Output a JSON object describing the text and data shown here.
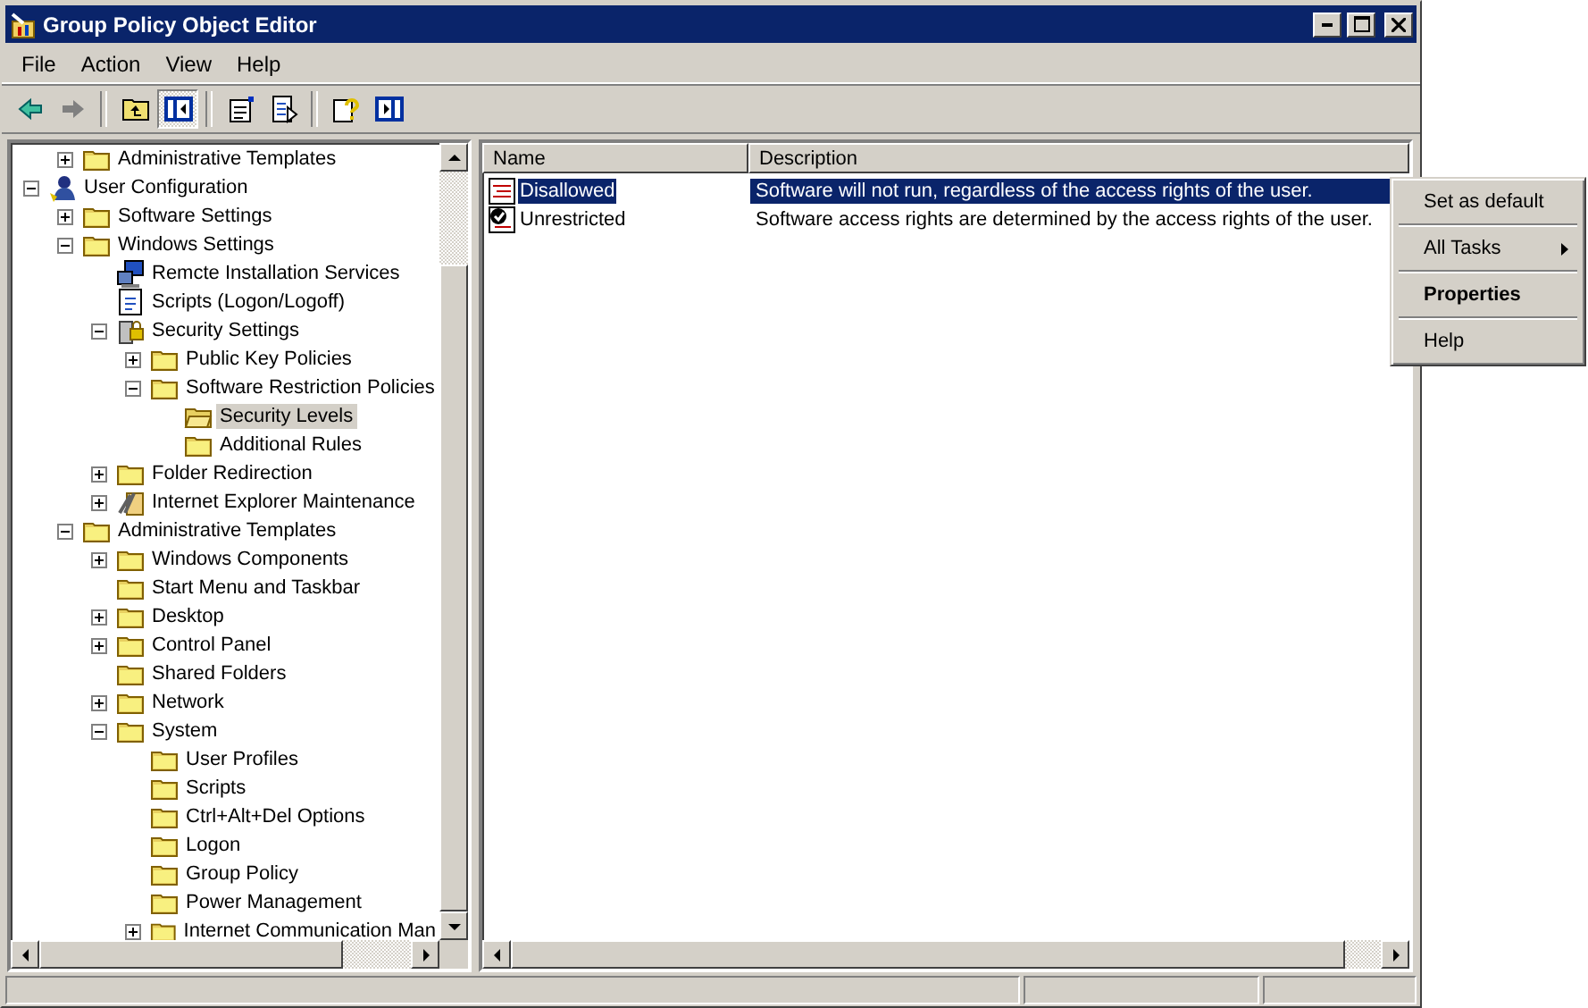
{
  "window": {
    "title": "Group Policy Object Editor"
  },
  "menu": [
    {
      "label": "File"
    },
    {
      "label": "Action"
    },
    {
      "label": "View"
    },
    {
      "label": "Help"
    }
  ],
  "toolbar": [
    {
      "kind": "back",
      "disabled": false
    },
    {
      "kind": "forward",
      "disabled": true
    },
    {
      "kind": "separator"
    },
    {
      "kind": "up",
      "pressed": false
    },
    {
      "kind": "tree",
      "pressed": true
    },
    {
      "kind": "separator"
    },
    {
      "kind": "properties",
      "pressed": false
    },
    {
      "kind": "export",
      "pressed": false
    },
    {
      "kind": "separator"
    },
    {
      "kind": "help",
      "pressed": false
    },
    {
      "kind": "pane",
      "pressed": false
    }
  ],
  "tree": [
    {
      "kind": "cut-off",
      "children": [
        {
          "label": "Administrative Templates",
          "kind": "folder",
          "expanded": false,
          "selected": false
        }
      ]
    },
    {
      "label": "User Configuration",
      "kind": "user",
      "expanded": true,
      "selected": false,
      "children": [
        {
          "label": "Software Settings",
          "kind": "folder",
          "expanded": false,
          "selected": false
        },
        {
          "label": "Windows Settings",
          "kind": "folder",
          "expanded": true,
          "selected": false,
          "children": [
            {
              "label": "Remcte Installation Services",
              "kind": "remote",
              "selected": false
            },
            {
              "label": "Scripts (Logon/Logoff)",
              "kind": "scripts",
              "selected": false
            },
            {
              "label": "Security Settings",
              "kind": "security",
              "expanded": true,
              "selected": false,
              "children": [
                {
                  "label": "Public Key Policies",
                  "kind": "folder",
                  "expanded": false,
                  "selected": false
                },
                {
                  "label": "Software Restriction Policies",
                  "kind": "folder",
                  "expanded": true,
                  "selected": false,
                  "children": [
                    {
                      "label": "Security Levels",
                      "kind": "open-folder",
                      "selected": true
                    },
                    {
                      "label": "Additional Rules",
                      "kind": "folder",
                      "selected": false
                    }
                  ]
                }
              ]
            },
            {
              "label": "Folder Redirection",
              "kind": "folder",
              "expanded": false,
              "selected": false
            },
            {
              "label": "Internet Explorer Maintenance",
              "kind": "ie",
              "expanded": false,
              "selected": false
            }
          ]
        },
        {
          "label": "Administrative Templates",
          "kind": "folder",
          "expanded": true,
          "selected": false,
          "children": [
            {
              "label": "Windows Components",
              "kind": "folder",
              "expanded": false,
              "selected": false
            },
            {
              "label": "Start Menu and Taskbar",
              "kind": "folder",
              "selected": false
            },
            {
              "label": "Desktop",
              "kind": "folder",
              "expanded": false,
              "selected": false
            },
            {
              "label": "Control Panel",
              "kind": "folder",
              "expanded": false,
              "selected": false
            },
            {
              "label": "Shared Folders",
              "kind": "folder",
              "selected": false
            },
            {
              "label": "Network",
              "kind": "folder",
              "expanded": false,
              "selected": false
            },
            {
              "label": "System",
              "kind": "folder",
              "expanded": true,
              "selected": false,
              "children": [
                {
                  "label": "User Profiles",
                  "kind": "folder",
                  "selected": false
                },
                {
                  "label": "Scripts",
                  "kind": "folder",
                  "selected": false
                },
                {
                  "label": "Ctrl+Alt+Del Options",
                  "kind": "folder",
                  "selected": false
                },
                {
                  "label": "Logon",
                  "kind": "folder",
                  "selected": false
                },
                {
                  "label": "Group Policy",
                  "kind": "folder",
                  "selected": false
                },
                {
                  "label": "Power Management",
                  "kind": "folder",
                  "selected": false
                },
                {
                  "label": "Internet Communication Man",
                  "kind": "folder",
                  "expanded": false,
                  "selected": false
                }
              ]
            }
          ]
        }
      ]
    }
  ],
  "list": {
    "columns": [
      "Name",
      "Description"
    ],
    "rows": [
      {
        "name": "Disallowed",
        "description": "Software will not run, regardless of the access rights of the user.",
        "kind": "disallowed",
        "selected": true
      },
      {
        "name": "Unrestricted",
        "description": "Software access rights are determined by the access rights of the user.",
        "kind": "unrestricted",
        "selected": false
      }
    ]
  },
  "context_menu": [
    {
      "label": "Set as default",
      "default": false,
      "submenu": false
    },
    {
      "label": "All Tasks",
      "default": false,
      "submenu": true
    },
    {
      "label": "Properties",
      "default": true,
      "submenu": false
    },
    {
      "label": "Help",
      "default": false,
      "submenu": false
    }
  ]
}
